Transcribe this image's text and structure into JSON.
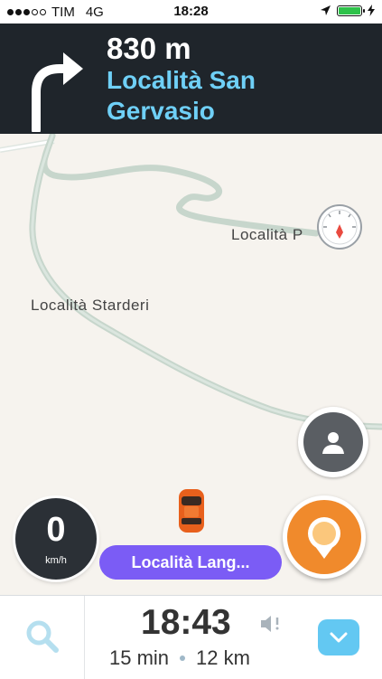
{
  "status_bar": {
    "carrier": "TIM",
    "network": "4G",
    "time": "18:28",
    "signal_bars_filled": 3,
    "signal_bars_total": 5,
    "battery_level": 1.0,
    "battery_color": "#2ec24a"
  },
  "navigation": {
    "distance": "830 m",
    "street": "Località San Gervasio",
    "turn_icon": "turn-right-arrow-icon",
    "street_color": "#6fd0f7",
    "banner_color": "#1f252b"
  },
  "map": {
    "labels": {
      "starderi": "Località Starderi",
      "p_partial": "Località P"
    }
  },
  "speedometer": {
    "value": "0",
    "unit": "km/h"
  },
  "destination": {
    "label": "Località Lang..."
  },
  "bottom_bar": {
    "eta": "18:43",
    "duration": "15 min",
    "distance": "12 km"
  },
  "colors": {
    "destination_pill": "#7b5cf5",
    "report_button": "#f08a2c",
    "expand_button": "#63c8f2"
  }
}
